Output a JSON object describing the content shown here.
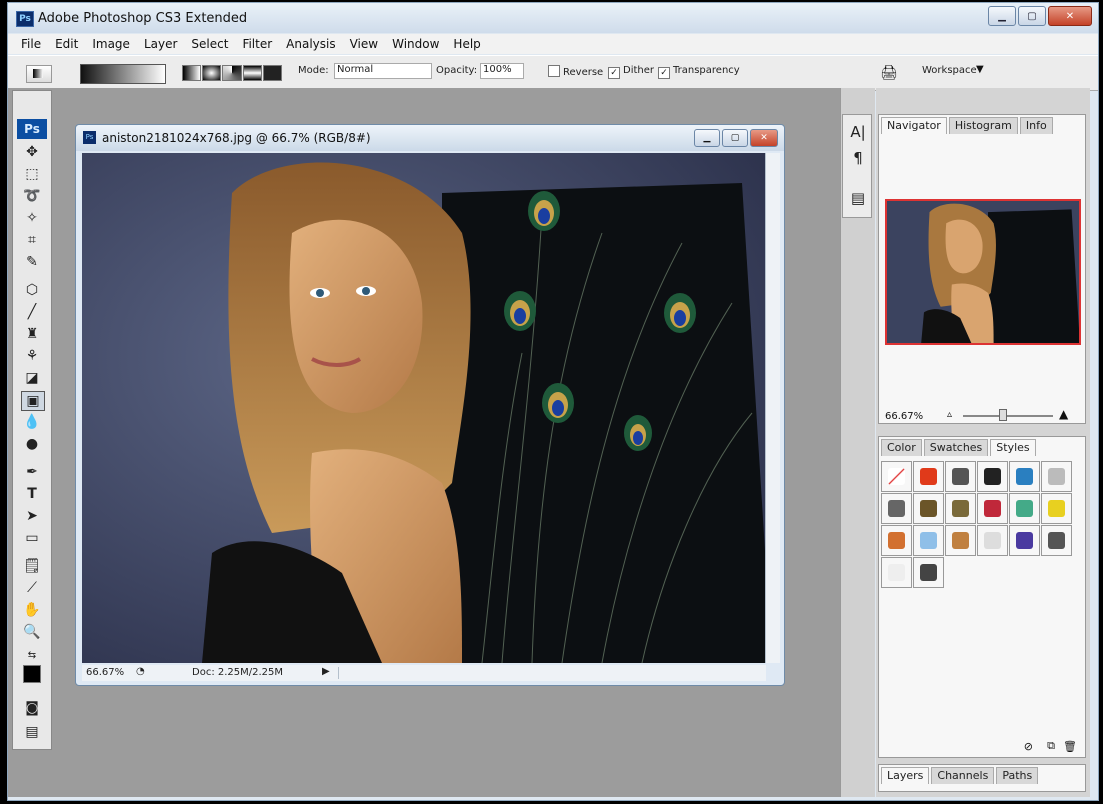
{
  "window": {
    "title": "Adobe Photoshop CS3 Extended",
    "app_icon": "Ps"
  },
  "menu": [
    "File",
    "Edit",
    "Image",
    "Layer",
    "Select",
    "Filter",
    "Analysis",
    "View",
    "Window",
    "Help"
  ],
  "options": {
    "mode_label": "Mode:",
    "mode_value": "Normal",
    "opacity_label": "Opacity:",
    "opacity_value": "100%",
    "reverse_label": "Reverse",
    "dither_label": "Dither",
    "transparency_label": "Transparency",
    "workspace_label": "Workspace"
  },
  "toolbox": {
    "logo": "Ps"
  },
  "document": {
    "title": "aniston2181024x768.jpg @ 66.7% (RGB/8#)",
    "zoom": "66.67%",
    "doc_size": "Doc: 2.25M/2.25M"
  },
  "navigator": {
    "tabs": [
      "Navigator",
      "Histogram",
      "Info"
    ],
    "zoom": "66.67%"
  },
  "styles_panel": {
    "tabs": [
      "Color",
      "Swatches",
      "Styles"
    ],
    "swatches": [
      "#ffffff",
      "#e03a1a",
      "#555555",
      "#222222",
      "#2a7fc0",
      "#bbbbbb",
      "#666666",
      "#6b5528",
      "#7a6a3a",
      "#c0283a",
      "#44aa88",
      "#e8d020",
      "#d27030",
      "#8fbfe8",
      "#c08040",
      "#dddddd",
      "#4a3aa0",
      "#555555",
      "#eeeeee",
      "#444444"
    ]
  },
  "layers_panel": {
    "tabs": [
      "Layers",
      "Channels",
      "Paths"
    ]
  },
  "colors": {
    "accent": "#0b4ea2",
    "close_red": "#c44228",
    "navigator_frame": "#dd3333"
  }
}
